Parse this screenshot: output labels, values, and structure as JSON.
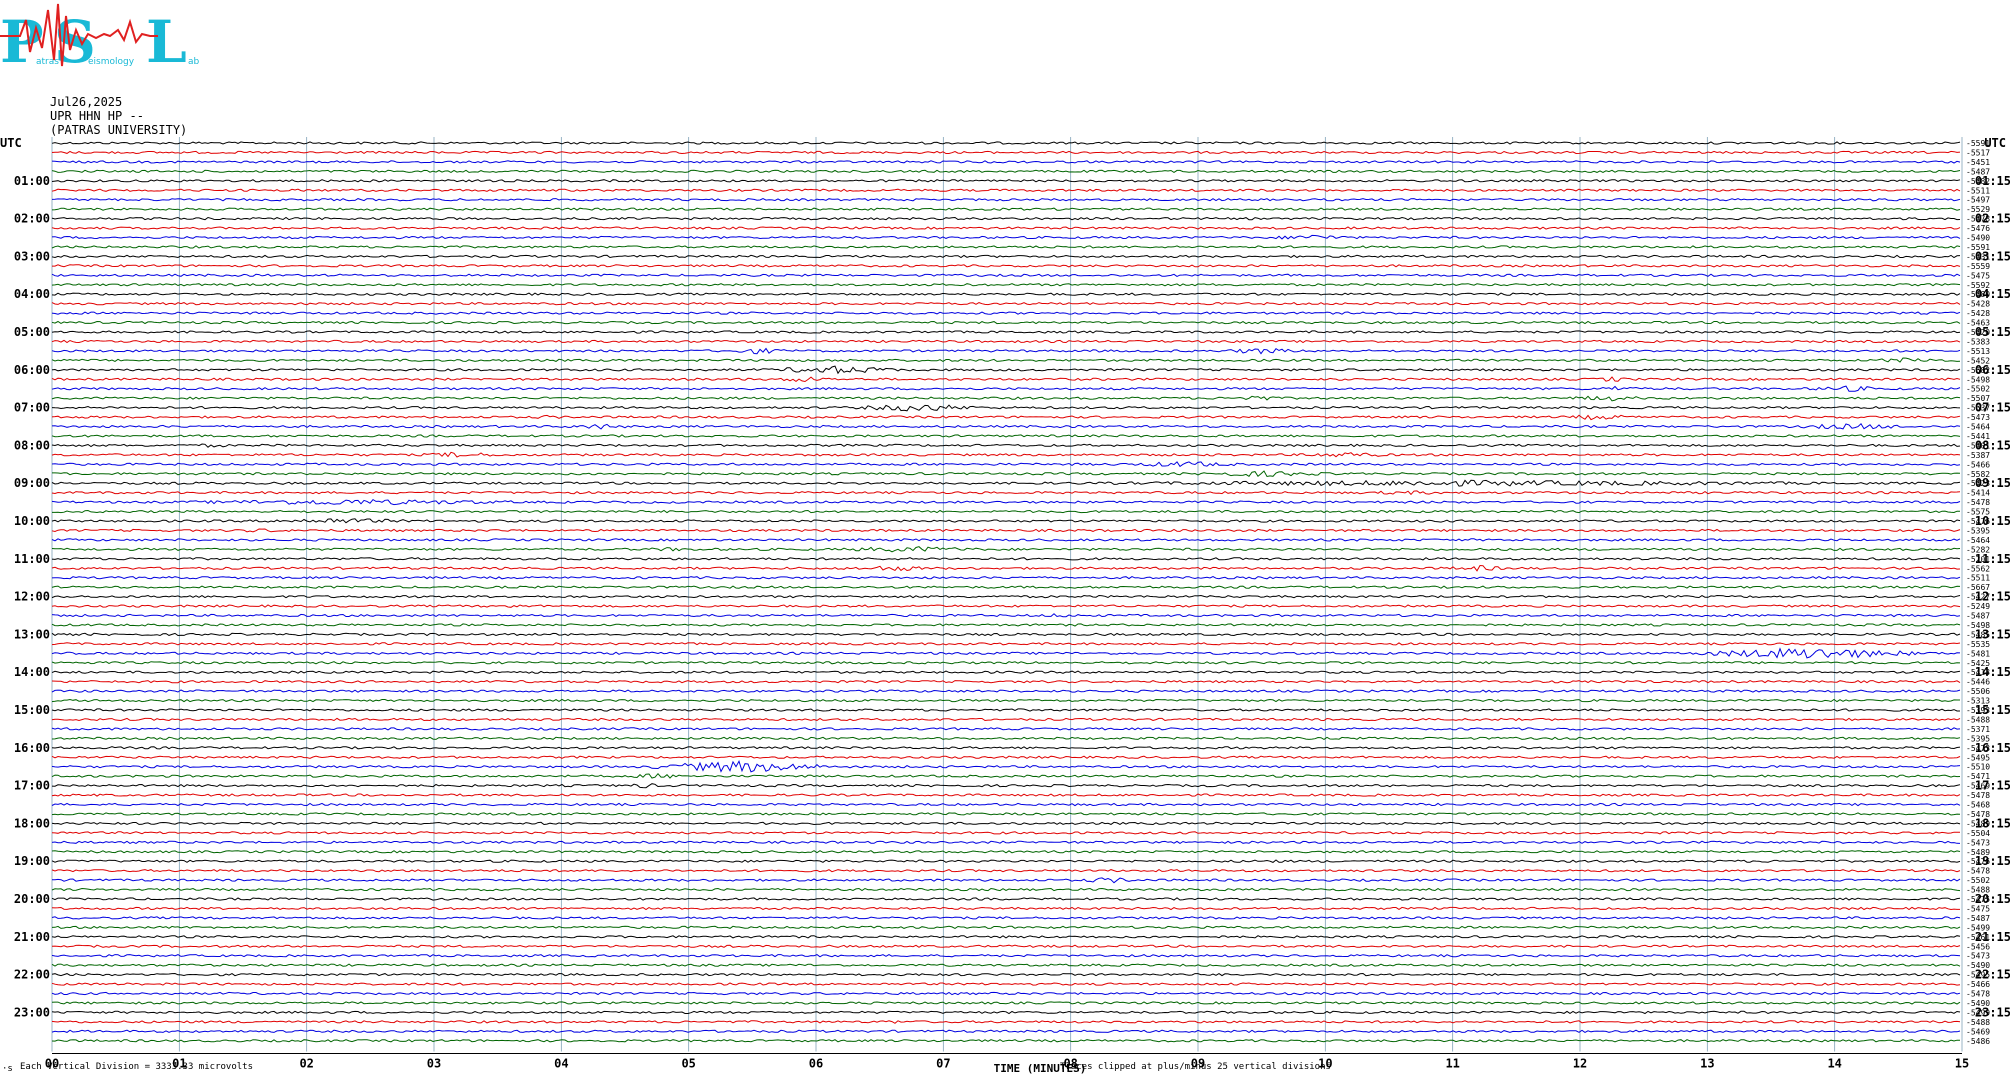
{
  "logo": {
    "letters": [
      "P",
      "S",
      "L"
    ],
    "words": [
      "atras",
      "eismology",
      "ab"
    ]
  },
  "header": {
    "date": "Jul26,2025",
    "station": "UPR HHN HP --",
    "institution": "(PATRAS UNIVERSITY)"
  },
  "footer": {
    "scale_note": "Each Vertical Division = 3333.33 microvolts",
    "clip_note": "Traces clipped at plus/minus 25 vertical divisions",
    "corner_mark": "·s"
  },
  "colors": {
    "trace_cycle": [
      "#000000",
      "#e00000",
      "#0000e0",
      "#006400"
    ],
    "grid": "#4a7a9a"
  },
  "chart_data": {
    "type": "line",
    "title": "",
    "xlabel": "TIME (MINUTES)",
    "x_ticks": [
      "00",
      "01",
      "02",
      "03",
      "04",
      "05",
      "06",
      "07",
      "08",
      "09",
      "10",
      "11",
      "12",
      "13",
      "14",
      "15"
    ],
    "xlim": [
      0,
      15
    ],
    "left_axis_label": "UTC",
    "right_axis_label": "UTC",
    "left_hour_labels": [
      "01:00",
      "02:00",
      "03:00",
      "04:00",
      "05:00",
      "06:00",
      "07:00",
      "08:00",
      "09:00",
      "10:00",
      "11:00",
      "12:00",
      "13:00",
      "14:00",
      "15:00",
      "16:00",
      "17:00",
      "18:00",
      "19:00",
      "20:00",
      "21:00",
      "22:00",
      "23:00"
    ],
    "right_hour_labels": [
      "01:15",
      "02:15",
      "03:15",
      "04:15",
      "05:15",
      "06:15",
      "07:15",
      "08:15",
      "09:15",
      "10:15",
      "11:15",
      "12:15",
      "13:15",
      "14:15",
      "15:15",
      "16:15",
      "17:15",
      "18:15",
      "19:15",
      "20:15",
      "21:15",
      "22:15",
      "23:15"
    ],
    "trace_count": 96,
    "trace_minutes": 15,
    "trace_offsets": [
      "-5591",
      "-5517",
      "-5451",
      "-5487",
      "-5482",
      "-5511",
      "-5497",
      "-5529",
      "-5478",
      "-5476",
      "-5490",
      "-5591",
      "-5431",
      "-5559",
      "-5475",
      "-5592",
      "-5480",
      "-5428",
      "-5428",
      "-5463",
      "-5420",
      "-5383",
      "-5513",
      "-5452",
      "-5582",
      "-5498",
      "-5502",
      "-5507",
      "-5537",
      "-5473",
      "-5464",
      "-5441",
      "-5401",
      "-5387",
      "-5466",
      "-5582",
      "-5423",
      "-5414",
      "-5478",
      "-5575",
      "-5476",
      "-5395",
      "-5464",
      "-5282",
      "-5201",
      "-5562",
      "-5511",
      "-5667",
      "-5427",
      "-5249",
      "-5487",
      "-5498",
      "-5485",
      "-5535",
      "-5481",
      "-5425",
      "-5413",
      "-5446",
      "-5506",
      "-5313",
      "-5393",
      "-5488",
      "-5371",
      "-5395",
      "-5473",
      "-5495",
      "-5510",
      "-5471",
      "-5469",
      "-5478",
      "-5468",
      "-5478",
      "-5489",
      "-5504",
      "-5473",
      "-5489",
      "-5476",
      "-5478",
      "-5502",
      "-5488",
      "-5475",
      "-5475",
      "-5487",
      "-5499",
      "-5461",
      "-5456",
      "-5473",
      "-5490",
      "-5495",
      "-5466",
      "-5478",
      "-5490",
      "-5499",
      "-5488",
      "-5469",
      "-5486"
    ],
    "events": [
      {
        "row": 10,
        "start": 9.5,
        "end": 10.3,
        "amp": 3
      },
      {
        "row": 22,
        "start": 5.2,
        "end": 5.9,
        "amp": 3
      },
      {
        "row": 22,
        "start": 9.1,
        "end": 9.9,
        "amp": 3
      },
      {
        "row": 23,
        "start": 14.2,
        "end": 15,
        "amp": 3
      },
      {
        "row": 24,
        "start": 5.5,
        "end": 6.8,
        "amp": 4
      },
      {
        "row": 25,
        "start": 5.6,
        "end": 6.2,
        "amp": 3
      },
      {
        "row": 25,
        "start": 12.1,
        "end": 12.4,
        "amp": 3
      },
      {
        "row": 26,
        "start": 12.1,
        "end": 12.5,
        "amp": 3
      },
      {
        "row": 26,
        "start": 13.7,
        "end": 14.5,
        "amp": 3
      },
      {
        "row": 27,
        "start": 9.2,
        "end": 9.7,
        "amp": 3
      },
      {
        "row": 27,
        "start": 11.8,
        "end": 12.6,
        "amp": 3
      },
      {
        "row": 28,
        "start": 6.2,
        "end": 7.4,
        "amp": 4
      },
      {
        "row": 29,
        "start": 3.7,
        "end": 4.1,
        "amp": 2
      },
      {
        "row": 29,
        "start": 11.8,
        "end": 12.5,
        "amp": 3
      },
      {
        "row": 30,
        "start": 4.0,
        "end": 4.6,
        "amp": 3
      },
      {
        "row": 30,
        "start": 13.5,
        "end": 14.8,
        "amp": 3
      },
      {
        "row": 32,
        "start": 1.0,
        "end": 1.5,
        "amp": 2
      },
      {
        "row": 33,
        "start": 2.8,
        "end": 3.6,
        "amp": 3
      },
      {
        "row": 33,
        "start": 9.7,
        "end": 10.6,
        "amp": 3
      },
      {
        "row": 34,
        "start": 8.3,
        "end": 9.5,
        "amp": 3
      },
      {
        "row": 35,
        "start": 8.8,
        "end": 10.2,
        "amp": 3
      },
      {
        "row": 36,
        "start": 7.2,
        "end": 15,
        "amp": 3
      },
      {
        "row": 37,
        "start": 10.1,
        "end": 11.2,
        "amp": 2
      },
      {
        "row": 38,
        "start": 0.5,
        "end": 4.2,
        "amp": 3
      },
      {
        "row": 40,
        "start": 1.5,
        "end": 3.0,
        "amp": 3
      },
      {
        "row": 41,
        "start": 1.3,
        "end": 2.0,
        "amp": 2
      },
      {
        "row": 43,
        "start": 4.5,
        "end": 5.2,
        "amp": 2
      },
      {
        "row": 43,
        "start": 6.0,
        "end": 7.5,
        "amp": 3
      },
      {
        "row": 45,
        "start": 6.2,
        "end": 7.0,
        "amp": 3
      },
      {
        "row": 45,
        "start": 10.9,
        "end": 11.5,
        "amp": 3
      },
      {
        "row": 49,
        "start": 3.4,
        "end": 3.8,
        "amp": 2
      },
      {
        "row": 50,
        "start": 7.6,
        "end": 8.2,
        "amp": 2
      },
      {
        "row": 53,
        "start": 4.7,
        "end": 5.0,
        "amp": 2
      },
      {
        "row": 54,
        "start": 12.8,
        "end": 14.8,
        "amp": 6
      },
      {
        "row": 66,
        "start": 4.6,
        "end": 6.2,
        "amp": 6
      },
      {
        "row": 67,
        "start": 4.5,
        "end": 5.0,
        "amp": 3
      },
      {
        "row": 68,
        "start": 4.5,
        "end": 4.8,
        "amp": 3
      },
      {
        "row": 76,
        "start": 9.3,
        "end": 9.8,
        "amp": 2
      },
      {
        "row": 78,
        "start": 8.0,
        "end": 8.6,
        "amp": 3
      },
      {
        "row": 93,
        "start": 6.4,
        "end": 6.8,
        "amp": 2
      }
    ]
  }
}
